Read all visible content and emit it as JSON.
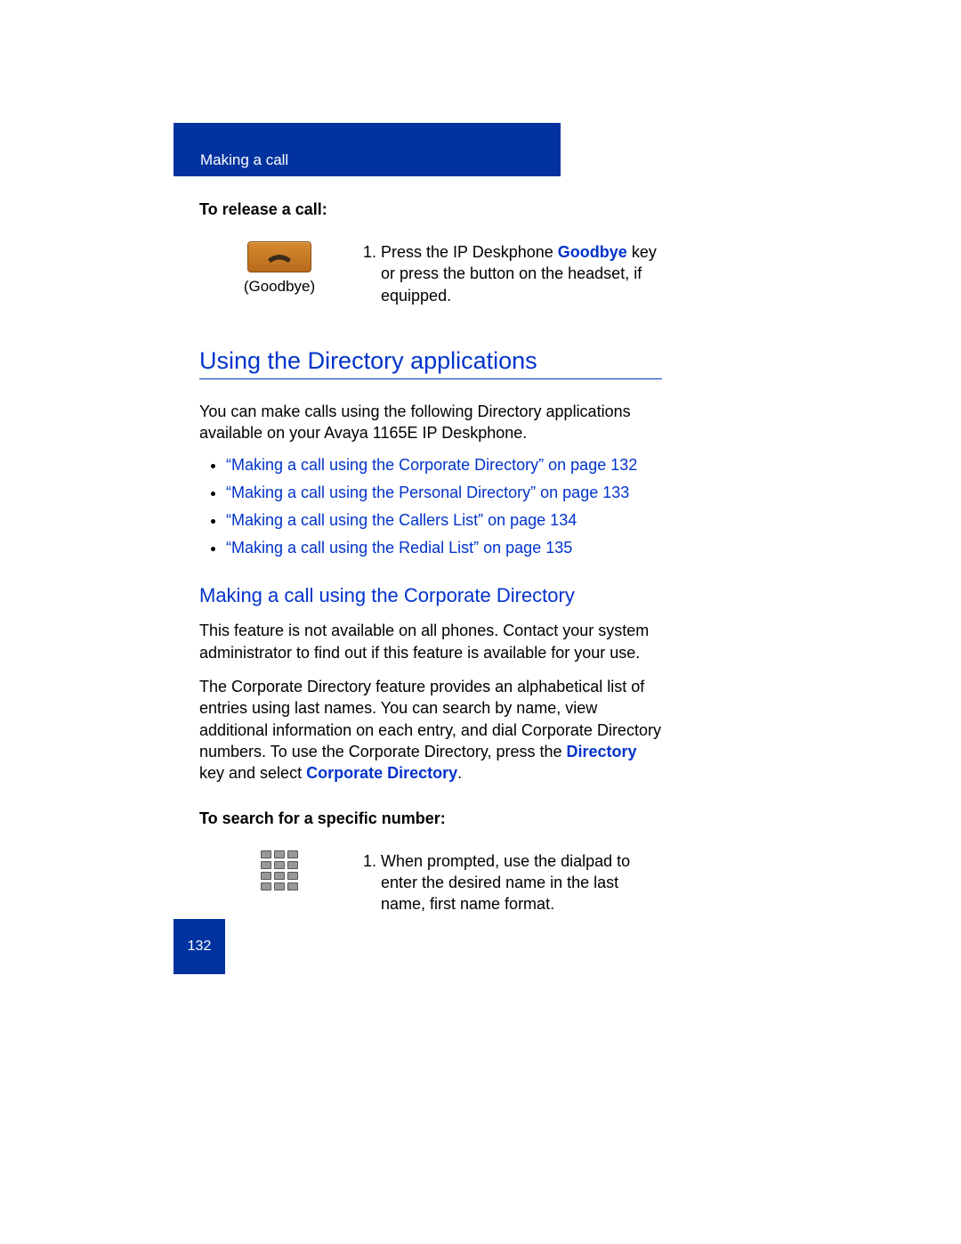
{
  "header": {
    "title": "Making a call"
  },
  "release": {
    "heading": "To release a call:",
    "icon_caption": "(Goodbye)",
    "step_prefix": "Press the IP Deskphone ",
    "step_key": "Goodbye",
    "step_suffix": " key or press the button on the headset, if equipped."
  },
  "directory": {
    "heading": "Using the Directory applications",
    "intro": "You can make calls using the following Directory applications available on your Avaya 1165E IP Deskphone.",
    "links": [
      "“Making a call using the Corporate Directory” on page 132",
      "“Making a call using the Personal Directory” on page 133",
      "“Making a call using the Callers List” on page 134",
      "“Making a call using the Redial List” on page 135"
    ]
  },
  "corporate": {
    "heading": "Making a call using the Corporate Directory",
    "p1": "This feature is not available on all phones. Contact your system administrator to find out if this feature is available for your use.",
    "p2_prefix": "The Corporate Directory feature provides an alphabetical list of entries using last names. You can search by name, view additional information on each entry, and dial Corporate Directory numbers. To use the Corporate Directory, press the ",
    "p2_key1": "Directory",
    "p2_mid": " key and select ",
    "p2_key2": "Corporate Directory",
    "p2_suffix": "."
  },
  "search": {
    "heading": "To search for a specific number:",
    "step": "When prompted, use the dialpad to enter the desired name in the last name, first name format."
  },
  "footer": {
    "page": "132"
  }
}
